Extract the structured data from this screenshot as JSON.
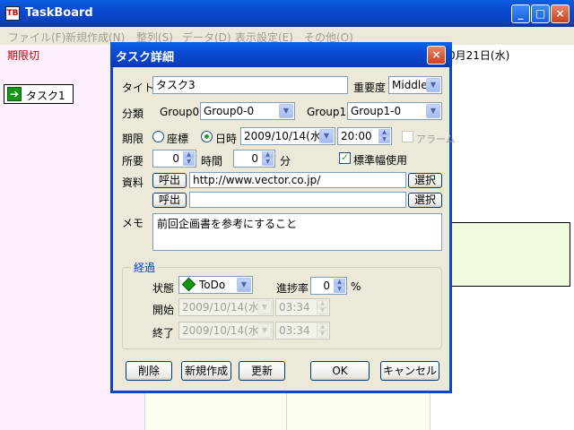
{
  "window": {
    "app_icon_text": "TB",
    "title": "TaskBoard",
    "minimize": "_",
    "maximize": "□",
    "close": "×"
  },
  "menu": [
    "ファイル(F)",
    "新規作成(N)",
    "整列(S)",
    "データ(D)",
    "表示設定(E)",
    "その他(O)"
  ],
  "board": {
    "overdue_label": "期限切",
    "date_header": "0月21日(水)",
    "task_card_label": "タスク1",
    "task_arrow": "➔"
  },
  "dialog": {
    "title": "タスク詳細",
    "close": "×",
    "title_label": "タイトル",
    "title_value": "タスク3",
    "priority_label": "重要度",
    "priority_value": "Middle",
    "category_label": "分類",
    "group0_label": "Group0",
    "group0_value": "Group0-0",
    "group1_label": "Group1",
    "group1_value": "Group1-0",
    "deadline_label": "期限",
    "radio_coord": "座標",
    "radio_datetime": "日時",
    "date_value": "2009/10/14(水)",
    "time_value": "20:00",
    "alarm_label": "アラーム",
    "required_label": "所要",
    "hours_value": "0",
    "hours_unit": "時間",
    "minutes_value": "0",
    "minutes_unit": "分",
    "standard_width_label": "標準幅使用",
    "resources_label": "資料",
    "call_button": "呼出",
    "resource1_value": "http://www.vector.co.jp/",
    "resource2_value": "",
    "select_button": "選択",
    "memo_label": "メモ",
    "memo_value": "前回企画書を参考にすること",
    "progress_group": "経過",
    "status_label": "状態",
    "status_value": "ToDo",
    "progress_label": "進捗率",
    "progress_value": "0",
    "progress_unit": "%",
    "start_label": "開始",
    "start_date": "2009/10/14(水)",
    "start_time": "03:34",
    "end_label": "終了",
    "end_date": "2009/10/14(水)",
    "end_time": "03:34",
    "delete_button": "削除",
    "new_button": "新規作成",
    "update_button": "更新",
    "ok_button": "OK",
    "cancel_button": "キャンセル"
  },
  "icons": {
    "dropdown": "▼",
    "spin_up": "▲",
    "spin_down": "▼",
    "check": "✓"
  }
}
